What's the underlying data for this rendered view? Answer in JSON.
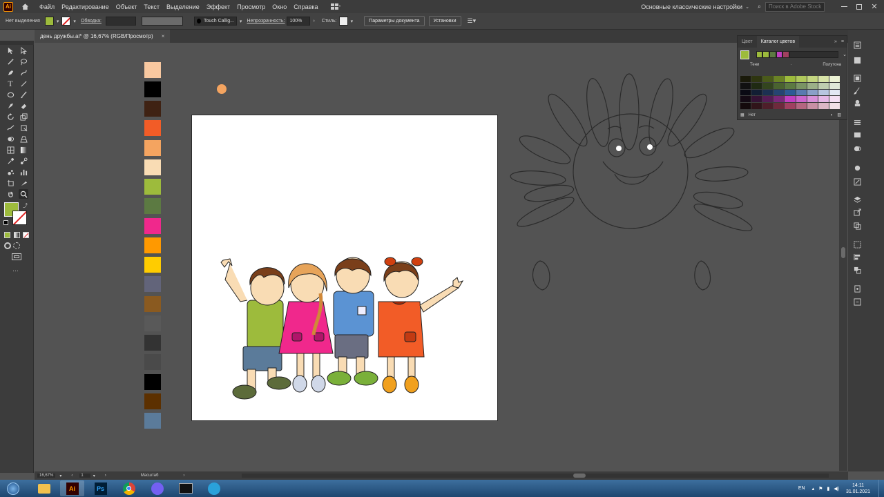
{
  "app": {
    "logo": "Ai",
    "home_icon": "home-icon"
  },
  "menu": [
    "Файл",
    "Редактирование",
    "Объект",
    "Текст",
    "Выделение",
    "Эффект",
    "Просмотр",
    "Окно",
    "Справка"
  ],
  "workspace": "Основные классические настройки",
  "search_placeholder": "Поиск в Adobe Stock",
  "control": {
    "selection_label": "Нет выделения",
    "fill_color": "#9dbb3c",
    "stroke_label": "Обводка:",
    "brush": "Touch Callig...",
    "opacity_label": "Непрозрачность:",
    "opacity_value": "100%",
    "style_label": "Стиль:",
    "doc_settings": "Параметры документа",
    "prefs": "Установки"
  },
  "document_tab": {
    "title": "день дружбы.ai* @ 16,67% (RGB/Просмотр)",
    "close": "×"
  },
  "tools": {
    "fill_color": "#9dbb3c",
    "more": "···"
  },
  "swatches": [
    "#f8c8a0",
    "#000000",
    "#3f2213",
    "#f25c27",
    "#f4a460",
    "#f9dcb4",
    "#9dbb3c",
    "#5c7a42",
    "#f0288c",
    "#ff9900",
    "#ffcc00",
    "#62647a",
    "#8a5a20",
    "#595959",
    "#333333",
    "#4a4a4a",
    "#000000",
    "#5c3000",
    "#5b7b9a"
  ],
  "color_panel": {
    "tab_color": "Цвет",
    "tab_guide": "Каталог цветов",
    "shades": "Тени",
    "tints": "Полутона",
    "none": "Нет",
    "harmony": [
      "#9dbb3c",
      "#9dbb3c",
      "#5c7a42",
      "#c040c0",
      "#a04060"
    ]
  },
  "status": {
    "zoom": "16,67%",
    "artboard": "1",
    "tool": "Масштаб"
  },
  "taskbar": {
    "lang": "EN",
    "time": "14:11",
    "date": "31.01.2021"
  }
}
